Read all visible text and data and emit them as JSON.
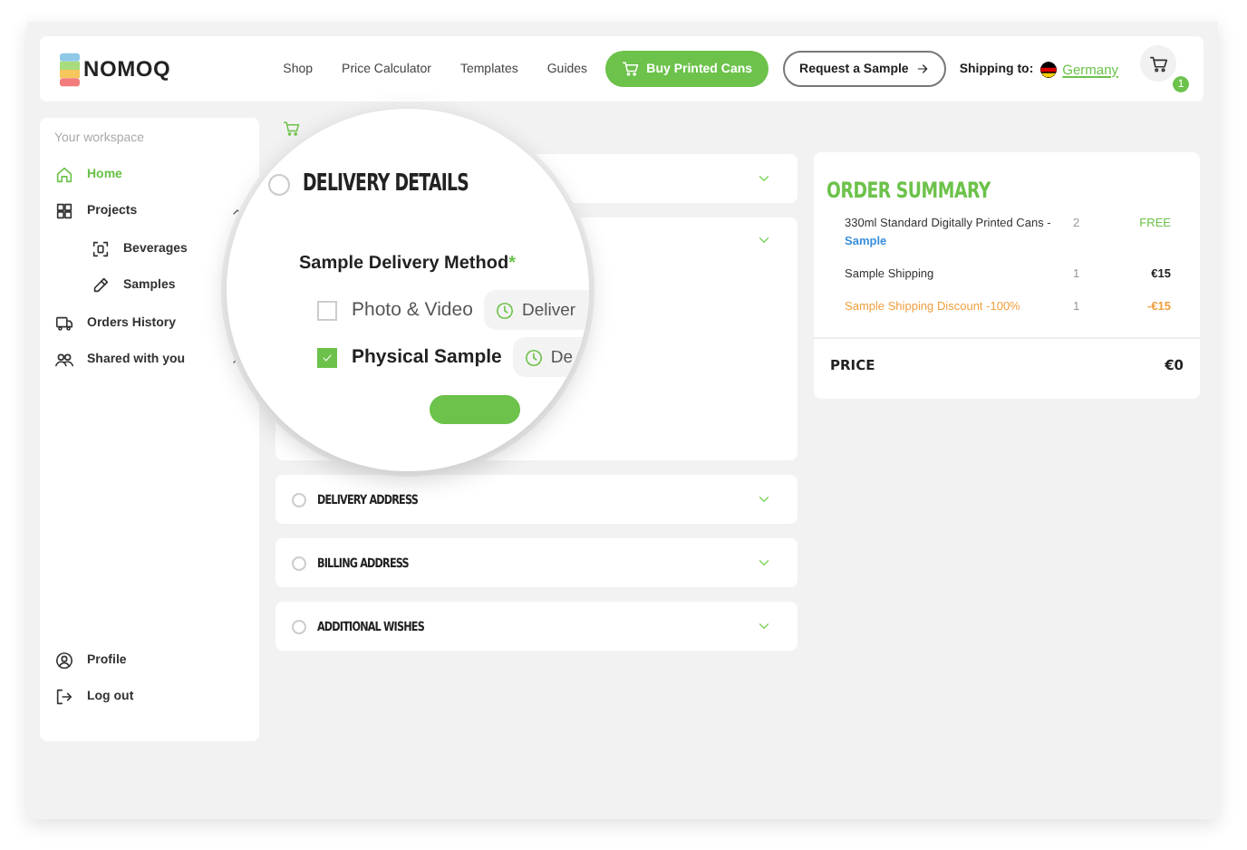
{
  "header": {
    "logo": "NOMOQ",
    "nav": [
      {
        "label": "Shop"
      },
      {
        "label": "Price Calculator"
      },
      {
        "label": "Templates"
      },
      {
        "label": "Guides"
      }
    ],
    "buy_button": "Buy Printed Cans",
    "sample_button": "Request a Sample",
    "shipping_label": "Shipping to:",
    "country": "Germany",
    "cart_count": "1"
  },
  "sidebar": {
    "workspace_label": "Your workspace",
    "items": [
      {
        "label": "Home",
        "selected": true
      },
      {
        "label": "Projects",
        "selected": false,
        "expanded": true,
        "children": [
          {
            "label": "Beverages",
            "selected": false
          },
          {
            "label": "Samples",
            "selected": false
          }
        ]
      },
      {
        "label": "Orders History",
        "selected": false
      },
      {
        "label": "Shared with you",
        "selected": false,
        "expanded": true
      }
    ],
    "bottom_items": [
      {
        "label": "Profile"
      },
      {
        "label": "Log out"
      }
    ]
  },
  "checkout": {
    "sections": [
      {
        "title": "DELIVERY ADDRESS",
        "selected": false
      },
      {
        "title": "BILLING ADDRESS",
        "selected": false
      },
      {
        "title": "ADDITIONAL WISHES",
        "selected": false
      }
    ]
  },
  "magnifier": {
    "section_title": "DELIVERY DETAILS",
    "selected": false,
    "field_label": "Sample Delivery Method",
    "required_mark": "*",
    "options": [
      {
        "label": "Photo & Video",
        "checked": false,
        "chip": "Deliver"
      },
      {
        "label": "Physical Sample",
        "checked": true,
        "chip": "De"
      }
    ]
  },
  "summary": {
    "title": "ORDER SUMMARY",
    "rows": [
      {
        "kind": "free",
        "name": "330ml Standard Digitally Printed Cans -",
        "note": "Sample",
        "qty": "2",
        "price": "FREE"
      },
      {
        "kind": "normal",
        "name": "Sample Shipping",
        "qty": "1",
        "price": "€15"
      },
      {
        "kind": "discount",
        "name": "Sample Shipping Discount -100%",
        "qty": "1",
        "price": "-€15"
      }
    ],
    "total_label": "PRICE",
    "total_value": "€0"
  }
}
